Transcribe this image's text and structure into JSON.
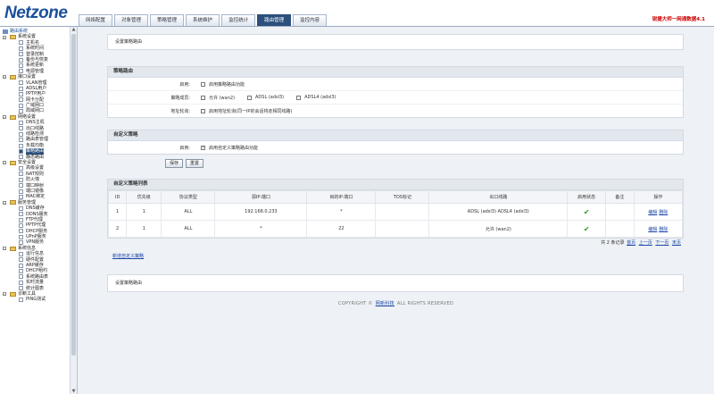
{
  "header": {
    "logo": "Netzone",
    "brand": "锐捷大师一网通数据4.1",
    "tabs": [
      "网络配置",
      "对象管理",
      "策略管理",
      "系统维护",
      "监控统计",
      "路由管理",
      "监控内容"
    ]
  },
  "sidebar": {
    "root": "路由系统",
    "items": [
      {
        "type": "group",
        "label": "系统设置"
      },
      {
        "type": "leaf",
        "label": "主机名"
      },
      {
        "type": "leaf",
        "label": "系统时间"
      },
      {
        "type": "leaf",
        "label": "登录控制"
      },
      {
        "type": "leaf",
        "label": "备份与恢复"
      },
      {
        "type": "leaf",
        "label": "系统更新"
      },
      {
        "type": "leaf",
        "label": "电源管理"
      },
      {
        "type": "group",
        "label": "接口设置"
      },
      {
        "type": "leaf",
        "label": "VLAN管理"
      },
      {
        "type": "leaf",
        "label": "ADSL用户"
      },
      {
        "type": "leaf",
        "label": "PPTP用户"
      },
      {
        "type": "leaf",
        "label": "网卡分配"
      },
      {
        "type": "leaf",
        "label": "广域网口"
      },
      {
        "type": "leaf",
        "label": "局域网口"
      },
      {
        "type": "group",
        "label": "网络设置"
      },
      {
        "type": "leaf",
        "label": "DNS主机"
      },
      {
        "type": "leaf",
        "label": "出口线路"
      },
      {
        "type": "leaf",
        "label": "线路检测"
      },
      {
        "type": "leaf",
        "label": "路由表管理"
      },
      {
        "type": "leaf",
        "label": "负载均衡"
      },
      {
        "type": "leaf",
        "label": "策略路由",
        "selected": true
      },
      {
        "type": "leaf",
        "label": "静态路由"
      },
      {
        "type": "group",
        "label": "安全设置"
      },
      {
        "type": "leaf",
        "label": "高级设置"
      },
      {
        "type": "leaf",
        "label": "NAT规则"
      },
      {
        "type": "leaf",
        "label": "防火墙"
      },
      {
        "type": "leaf",
        "label": "端口映射"
      },
      {
        "type": "leaf",
        "label": "端口镜像"
      },
      {
        "type": "leaf",
        "label": "MAC绑定"
      },
      {
        "type": "group",
        "label": "服务管理"
      },
      {
        "type": "leaf",
        "label": "DNS缓存"
      },
      {
        "type": "leaf",
        "label": "DDNS服务"
      },
      {
        "type": "leaf",
        "label": "FTP代理"
      },
      {
        "type": "leaf",
        "label": "PPTP代理"
      },
      {
        "type": "leaf",
        "label": "DHCP服务"
      },
      {
        "type": "leaf",
        "label": "UPnP服务"
      },
      {
        "type": "leaf",
        "label": "VPN服务"
      },
      {
        "type": "group",
        "label": "系统信息"
      },
      {
        "type": "leaf",
        "label": "运行信息"
      },
      {
        "type": "leaf",
        "label": "硬件配置"
      },
      {
        "type": "leaf",
        "label": "ARP缓存"
      },
      {
        "type": "leaf",
        "label": "DHCP租约"
      },
      {
        "type": "leaf",
        "label": "系统路由表"
      },
      {
        "type": "leaf",
        "label": "实时流量"
      },
      {
        "type": "leaf",
        "label": "统计图表"
      },
      {
        "type": "group",
        "label": "诊断工具"
      },
      {
        "type": "leaf",
        "label": "PING测试"
      }
    ]
  },
  "page": {
    "top_title": "设置策略路由",
    "policy": {
      "title": "策略路由",
      "enable_label": "启用:",
      "enable_text": "启用策略路由功能",
      "members_label": "策略成员:",
      "members": [
        "允许 (wan2)",
        "ADSL (adsl3)",
        "ADSL4 (adsl3)"
      ],
      "addr_label": "地址轮询:",
      "addr_text": "启用地址轮询(同一IP的会话将走相同线路)"
    },
    "custom": {
      "title": "自定义策略",
      "enable_label": "启用:",
      "enable_text": "启用自定义策略路由功能",
      "save": "保存",
      "reset": "重置"
    },
    "list": {
      "title": "自定义策略列表",
      "headers": [
        "ID",
        "优先级",
        "协议类型",
        "源IP:端口",
        "目的IP:端口",
        "TOS标记",
        "出口线路",
        "启用状态",
        "备注",
        "操作"
      ],
      "rows": [
        {
          "id": "1",
          "prio": "1",
          "proto": "ALL",
          "src": "192.168.0.233",
          "dst": "*",
          "tos": "",
          "line": "ADSL (adsl3) ADSL4 (adsl3)",
          "note": "",
          "edit": "编辑",
          "del": "删除"
        },
        {
          "id": "2",
          "prio": "1",
          "proto": "ALL",
          "src": "*",
          "dst": "22",
          "tos": "",
          "line": "允许 (wan2)",
          "note": "",
          "edit": "编辑",
          "del": "删除"
        }
      ],
      "pager": {
        "summary": "共 2 条记录",
        "first": "首页",
        "prev": "上一页",
        "next": "下一页",
        "last": "末页"
      }
    },
    "add_link": "新增自定义策略",
    "bottom_title": "设置策略路由",
    "copyright_pre": "COPYRIGHT ©",
    "copyright_link": "网新科技",
    "copyright_post": "ALL RIGHTS RESERVED"
  }
}
